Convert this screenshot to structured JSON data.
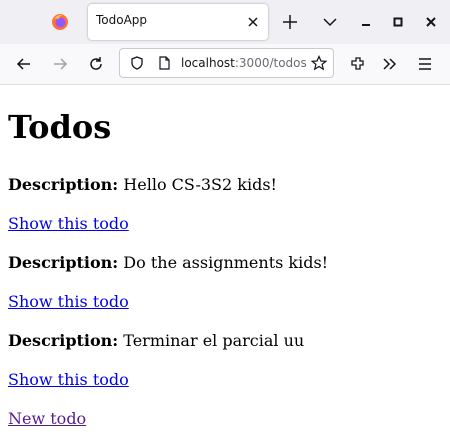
{
  "browser": {
    "tab_title": "TodoApp",
    "url_host": "localhost",
    "url_path": ":3000/todos"
  },
  "page": {
    "title": "Todos",
    "description_label": "Description:",
    "todos": [
      {
        "description": "Hello CS-3S2 kids!",
        "show_link": "Show this todo"
      },
      {
        "description": "Do the assignments kids!",
        "show_link": "Show this todo"
      },
      {
        "description": "Terminar el parcial uu",
        "show_link": "Show this todo"
      }
    ],
    "new_link": "New todo"
  },
  "colors": {
    "link": "#0000ee",
    "visited_link": "#551a8b",
    "tab_strip": "#f0f0f4"
  }
}
